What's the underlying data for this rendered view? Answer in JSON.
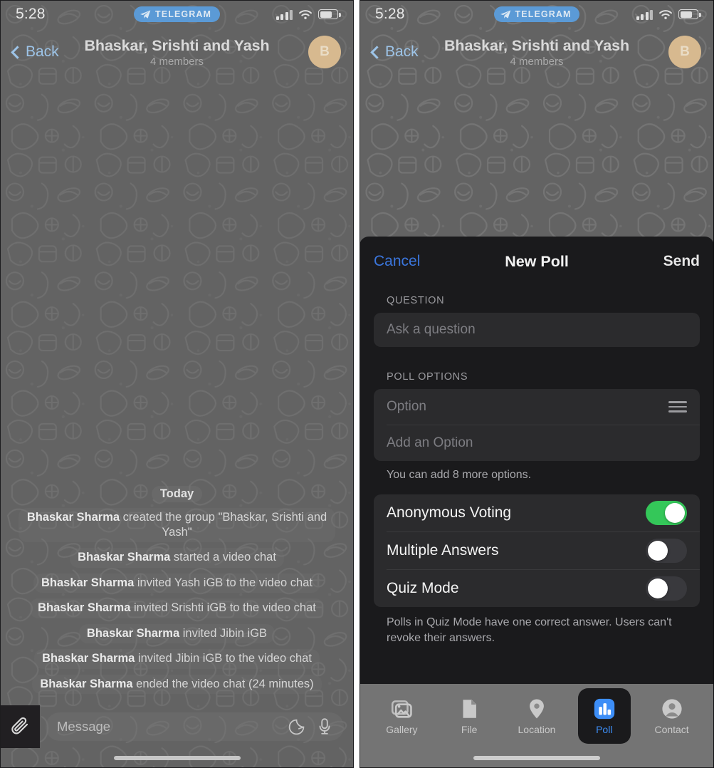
{
  "statusbar": {
    "time": "5:28",
    "app_badge": "TELEGRAM",
    "icons": {
      "signal": "signal-bars-icon",
      "wifi": "wifi-icon",
      "battery": "battery-icon"
    }
  },
  "navbar": {
    "back_label": "Back",
    "title": "Bhaskar, Srishti and Yash",
    "subtitle": "4 members",
    "avatar_initial": "B"
  },
  "chat": {
    "day_separator": "Today",
    "messages": [
      {
        "actor": "Bhaskar Sharma",
        "text": " created the group \"Bhaskar, Srishti and Yash\""
      },
      {
        "actor": "Bhaskar Sharma",
        "text": " started a video chat"
      },
      {
        "actor": "Bhaskar Sharma",
        "text": " invited Yash iGB to the video chat"
      },
      {
        "actor": "Bhaskar Sharma",
        "text": " invited Srishti iGB to the video chat"
      },
      {
        "actor": "Bhaskar Sharma",
        "text": " invited Jibin iGB"
      },
      {
        "actor": "Bhaskar Sharma",
        "text": " invited Jibin iGB to the video chat"
      },
      {
        "actor": "Bhaskar Sharma",
        "text": " ended the video chat (24 minutes)"
      }
    ]
  },
  "inputbar": {
    "attach_icon": "paperclip-icon",
    "placeholder": "Message",
    "sticker_icon": "sticker-icon",
    "mic_icon": "microphone-icon"
  },
  "poll_sheet": {
    "cancel_label": "Cancel",
    "title": "New Poll",
    "send_label": "Send",
    "question_section_label": "QUESTION",
    "question_placeholder": "Ask a question",
    "options_section_label": "POLL OPTIONS",
    "option_placeholder": "Option",
    "add_option_placeholder": "Add an Option",
    "options_hint": "You can add 8 more options.",
    "toggles": [
      {
        "label": "Anonymous Voting",
        "on": true
      },
      {
        "label": "Multiple Answers",
        "on": false
      },
      {
        "label": "Quiz Mode",
        "on": false
      }
    ],
    "quiz_note": "Polls in Quiz Mode have one correct answer. Users can't revoke their answers."
  },
  "attach_tabs": [
    {
      "label": "Gallery",
      "icon": "gallery-icon",
      "active": false
    },
    {
      "label": "File",
      "icon": "file-icon",
      "active": false
    },
    {
      "label": "Location",
      "icon": "location-pin-icon",
      "active": false
    },
    {
      "label": "Poll",
      "icon": "poll-bar-chart-icon",
      "active": true
    },
    {
      "label": "Contact",
      "icon": "contact-person-icon",
      "active": false
    }
  ],
  "colors": {
    "accent_blue": "#3d8ef7",
    "cancel_blue": "#3b76dd",
    "toggle_on_green": "#34c759",
    "sheet_bg": "#1a1a1c",
    "field_bg": "#2b2b2d",
    "wallpaper": "#6f6f6f",
    "avatar_bg": "#d7b98f"
  }
}
